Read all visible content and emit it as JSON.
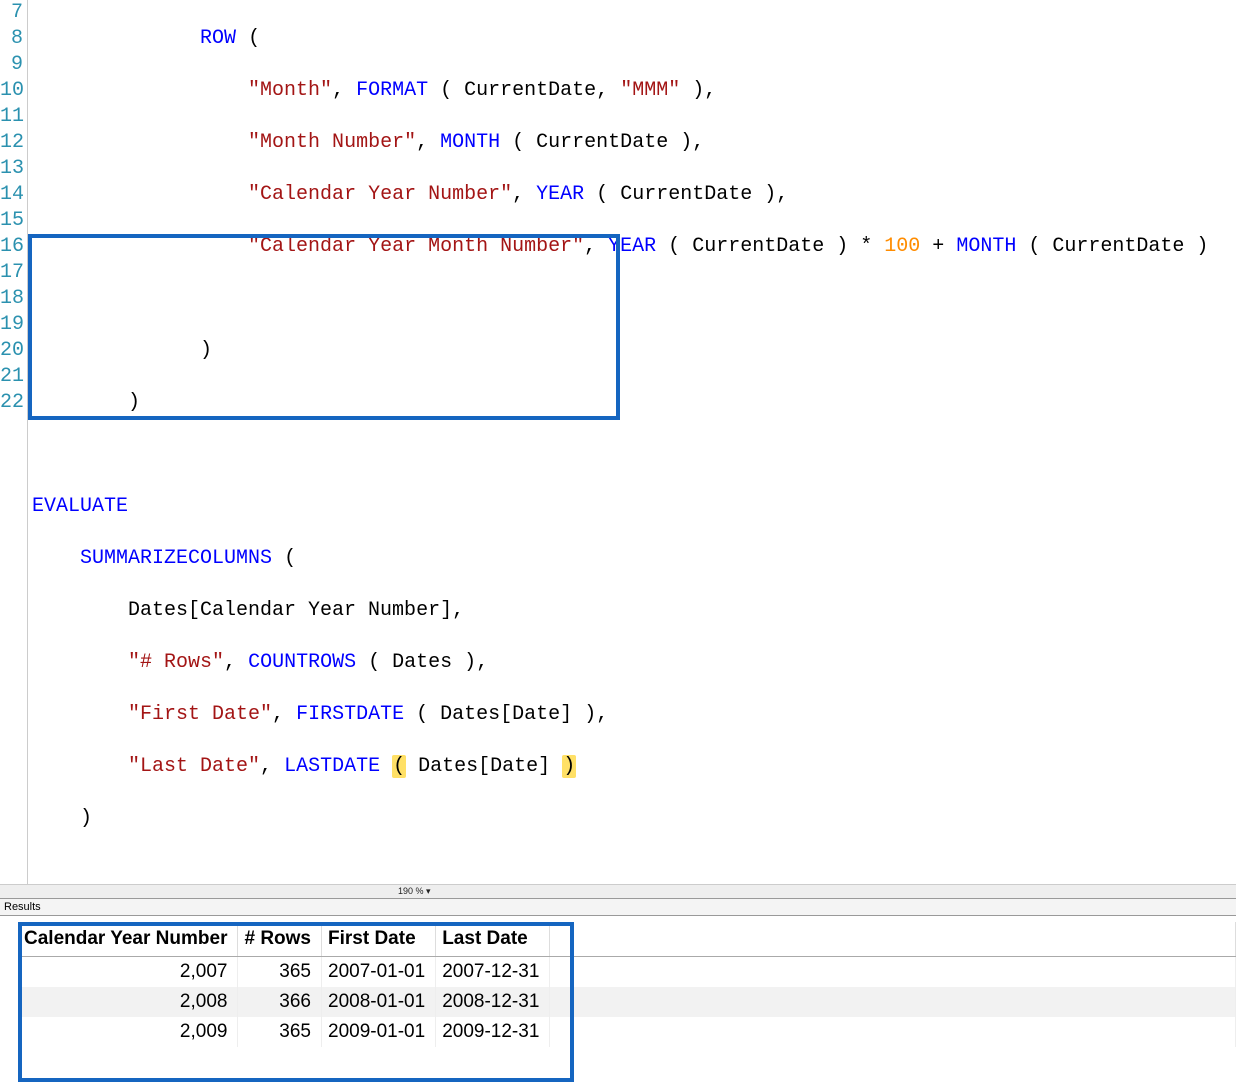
{
  "code": {
    "lines": {
      "l7": 7,
      "l8": 8,
      "l9": 9,
      "l10": 10,
      "l11": 11,
      "l12": 12,
      "l13": 13,
      "l14": 14,
      "l15": 15,
      "l16": 16,
      "l17": 17,
      "l18": 18,
      "l19": 19,
      "l20": 20,
      "l21": 21,
      "l22": 22
    },
    "t": {
      "row": "ROW",
      "format": "FORMAT",
      "month_fn": "MONTH",
      "year_fn": "YEAR",
      "evaluate": "EVALUATE",
      "summarize": "SUMMARIZECOLUMNS",
      "countrows": "COUNTROWS",
      "firstdate": "FIRSTDATE",
      "lastdate": "LASTDATE",
      "str_month": "\"Month\"",
      "str_mmm": "\"MMM\"",
      "str_month_num": "\"Month Number\"",
      "str_cal_year_num": "\"Calendar Year Number\"",
      "str_cal_year_month_num": "\"Calendar Year Month Number\"",
      "str_rows": "\"# Rows\"",
      "str_first_date": "\"First Date\"",
      "str_last_date": "\"Last Date\"",
      "currentdate": "CurrentDate",
      "dates_cal_year_num": "Dates[Calendar Year Number]",
      "dates": "Dates",
      "dates_date": "Dates[Date]",
      "n100": "100",
      "times": " * ",
      "plus": " + ",
      "op_paren": "(",
      "cl_paren": ")",
      "sp": " ",
      "comma": ",",
      "ind0": "",
      "ind2": "    ",
      "ind3": "        ",
      "row_ind": "              ",
      "row_arg_ind": "                  ",
      "close13": "              ",
      "close14": "        "
    }
  },
  "zoom": "190 % ▾",
  "results_label": "Results",
  "results": {
    "columns": {
      "c0": "Calendar Year Number",
      "c1": "# Rows",
      "c2": "First Date",
      "c3": "Last Date"
    },
    "rows": [
      {
        "year": "2,007",
        "count": "365",
        "first": "2007-01-01",
        "last": "2007-12-31"
      },
      {
        "year": "2,008",
        "count": "366",
        "first": "2008-01-01",
        "last": "2008-12-31"
      },
      {
        "year": "2,009",
        "count": "365",
        "first": "2009-01-01",
        "last": "2009-12-31"
      }
    ]
  },
  "chart_data": {
    "type": "table",
    "title": "Results",
    "columns": [
      "Calendar Year Number",
      "# Rows",
      "First Date",
      "Last Date"
    ],
    "rows": [
      [
        2007,
        365,
        "2007-01-01",
        "2007-12-31"
      ],
      [
        2008,
        366,
        "2008-01-01",
        "2008-12-31"
      ],
      [
        2009,
        365,
        "2009-01-01",
        "2009-12-31"
      ]
    ]
  }
}
